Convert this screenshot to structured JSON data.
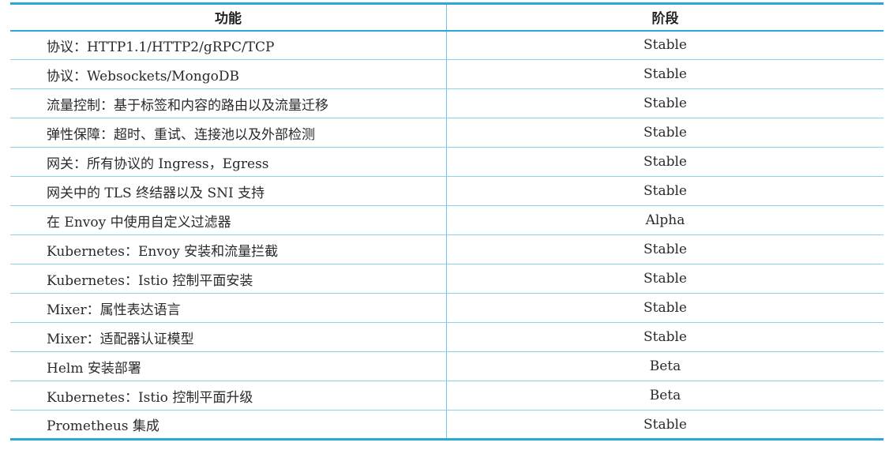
{
  "table": {
    "headers": {
      "feature": "功能",
      "stage": "阶段"
    },
    "rows": [
      {
        "feature": "协议：HTTP1.1/HTTP2/gRPC/TCP",
        "stage": "Stable"
      },
      {
        "feature": "协议：Websockets/MongoDB",
        "stage": "Stable"
      },
      {
        "feature": "流量控制：基于标签和内容的路由以及流量迁移",
        "stage": "Stable"
      },
      {
        "feature": "弹性保障：超时、重试、连接池以及外部检测",
        "stage": "Stable"
      },
      {
        "feature": "网关：所有协议的 Ingress，Egress",
        "stage": "Stable"
      },
      {
        "feature": "网关中的 TLS 终结器以及 SNI 支持",
        "stage": "Stable"
      },
      {
        "feature": "在 Envoy 中使用自定义过滤器",
        "stage": "Alpha"
      },
      {
        "feature": "Kubernetes：Envoy 安装和流量拦截",
        "stage": "Stable"
      },
      {
        "feature": "Kubernetes：Istio 控制平面安装",
        "stage": "Stable"
      },
      {
        "feature": "Mixer：属性表达语言",
        "stage": "Stable"
      },
      {
        "feature": "Mixer：适配器认证模型",
        "stage": "Stable"
      },
      {
        "feature": "Helm 安装部署",
        "stage": "Beta"
      },
      {
        "feature": "Kubernetes：Istio 控制平面升级",
        "stage": "Beta"
      },
      {
        "feature": "Prometheus 集成",
        "stage": "Stable"
      }
    ]
  },
  "colors": {
    "rule_accent": "#29a8d8",
    "row_divider": "#8fd0ec"
  }
}
